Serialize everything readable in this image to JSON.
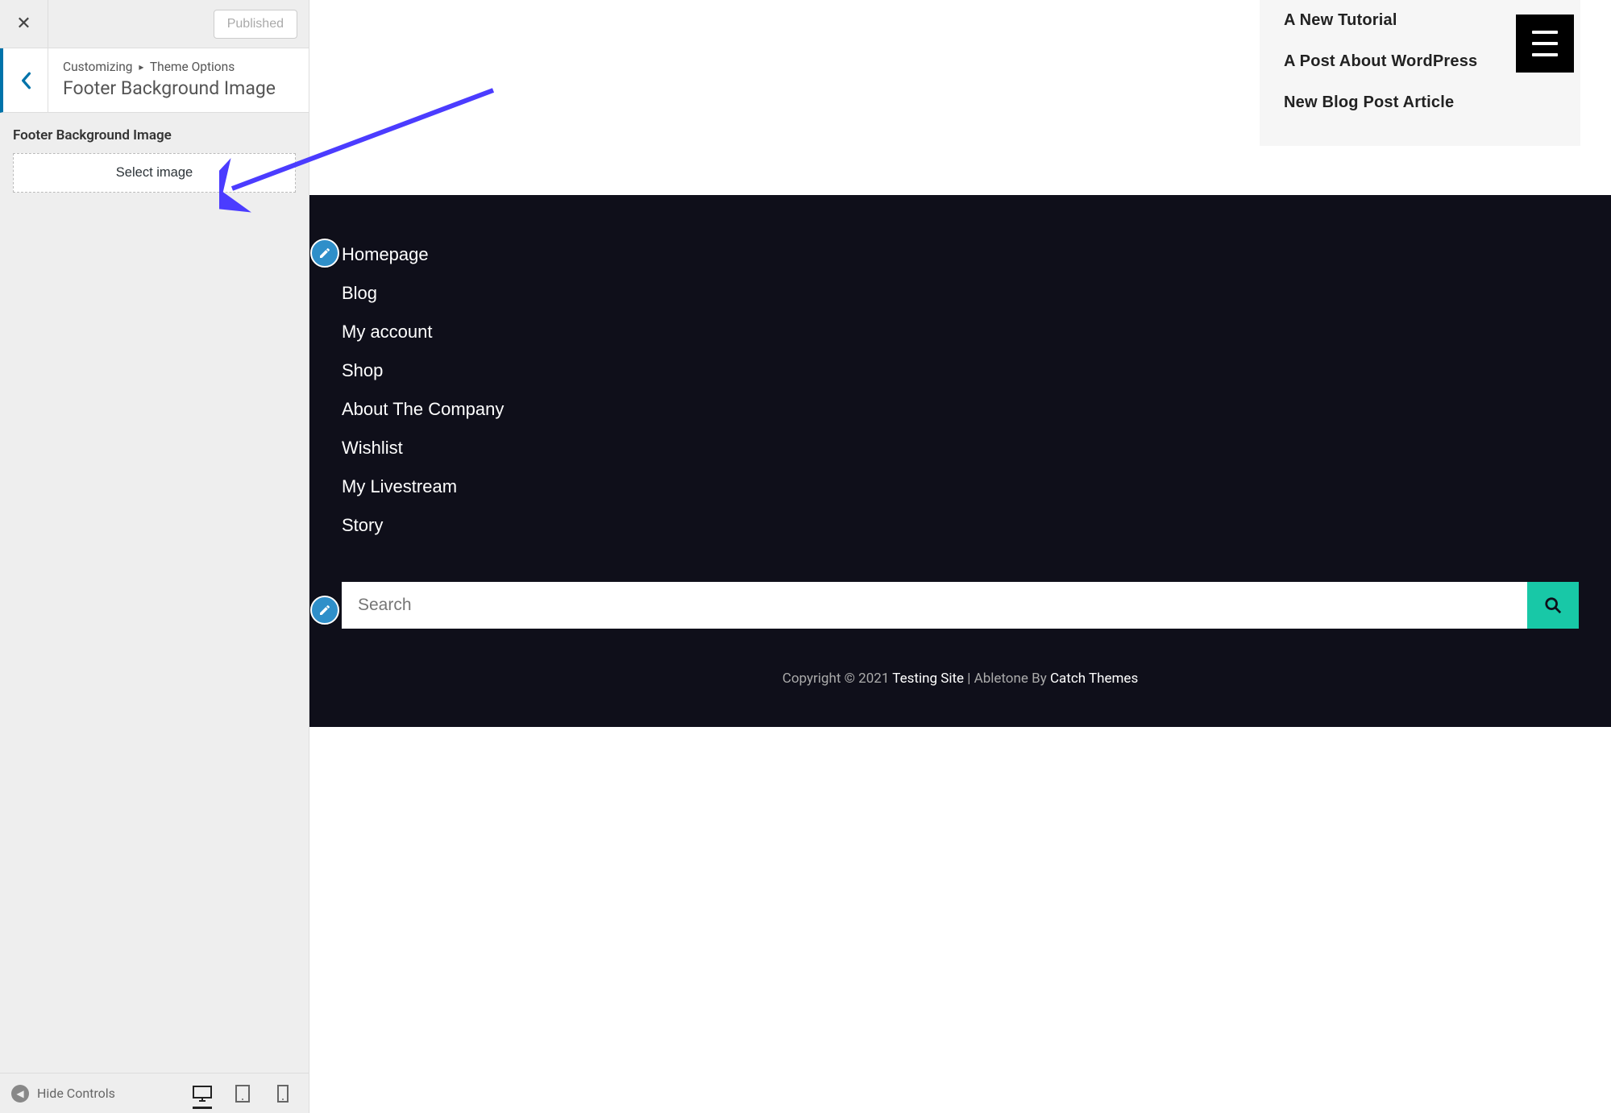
{
  "sidebar": {
    "published_label": "Published",
    "breadcrumb_parent": "Customizing",
    "breadcrumb_section": "Theme Options",
    "breadcrumb_title": "Footer Background Image",
    "field_label": "Footer Background Image",
    "select_image_label": "Select image",
    "hide_controls_label": "Hide Controls"
  },
  "preview": {
    "recent_posts": [
      "A New Tutorial",
      "A Post About WordPress",
      "New Blog Post Article"
    ],
    "footer_nav": [
      "Homepage",
      "Blog",
      "My account",
      "Shop",
      "About The Company",
      "Wishlist",
      "My Livestream",
      "Story"
    ],
    "search_placeholder": "Search",
    "copyright_prefix": "Copyright © 2021 ",
    "copyright_site": "Testing Site",
    "copyright_mid": " | Abletone By ",
    "copyright_theme": "Catch Themes"
  }
}
